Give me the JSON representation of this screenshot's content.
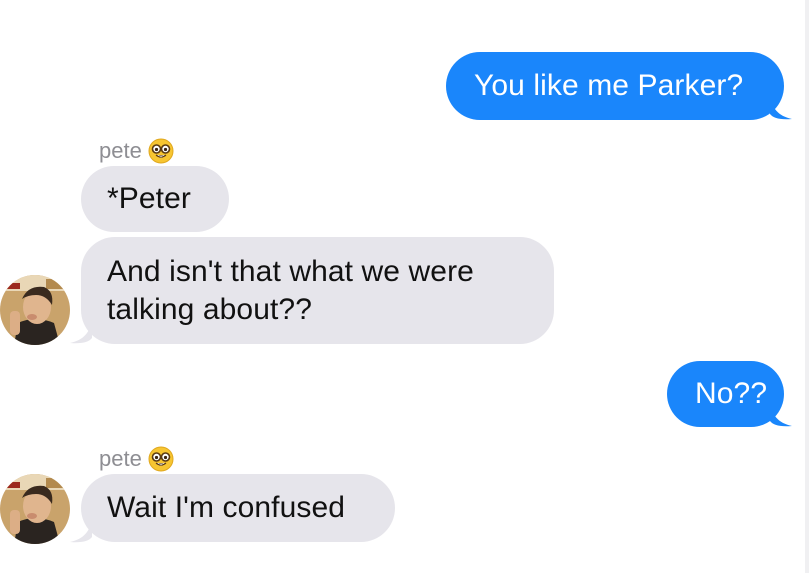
{
  "conversation": {
    "messages": [
      {
        "direction": "outgoing",
        "text": "You like me Parker?"
      },
      {
        "direction": "incoming",
        "sender": "pete",
        "text": "*Peter"
      },
      {
        "direction": "incoming",
        "text_line1": "And isn't that what we were",
        "text_line2": "talking about??"
      },
      {
        "direction": "outgoing",
        "text": "No??"
      },
      {
        "direction": "incoming",
        "sender": "pete",
        "text": "Wait I'm confused"
      }
    ]
  },
  "contact": {
    "name": "pete",
    "emoji_icon": "nerd-face-emoji",
    "avatar_icon": "contact-photo"
  },
  "colors": {
    "outgoing_bubble": "#1a86fb",
    "incoming_bubble": "#e6e5eb",
    "sender_label": "#8e8e93"
  }
}
